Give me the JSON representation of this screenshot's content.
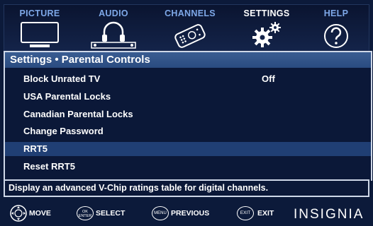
{
  "menu": {
    "tabs": [
      {
        "label": "PICTURE",
        "icon": "tv-icon"
      },
      {
        "label": "AUDIO",
        "icon": "headphones-icon"
      },
      {
        "label": "CHANNELS",
        "icon": "remote-icon"
      },
      {
        "label": "SETTINGS",
        "icon": "gears-icon",
        "active": true
      },
      {
        "label": "HELP",
        "icon": "question-icon"
      }
    ]
  },
  "panel": {
    "title": "Settings • Parental Controls",
    "items": [
      {
        "label": "Block Unrated TV",
        "value": "Off"
      },
      {
        "label": "USA Parental Locks"
      },
      {
        "label": "Canadian Parental Locks"
      },
      {
        "label": "Change Password"
      },
      {
        "label": "RRT5",
        "selected": true
      },
      {
        "label": "Reset RRT5"
      }
    ]
  },
  "description": "Display an advanced V-Chip ratings table for digital channels.",
  "footer": {
    "hints": [
      {
        "label": "MOVE",
        "icon": "dpad-icon"
      },
      {
        "button": "OK ENTER",
        "label": "SELECT"
      },
      {
        "button": "MENU",
        "label": "PREVIOUS"
      },
      {
        "button": "EXIT",
        "label": "EXIT"
      }
    ],
    "brand": "INSIGNIA"
  },
  "colors": {
    "background": "#0c1a3a",
    "title_bar": "#2a4b80",
    "selected_row": "#203f74",
    "tab_label": "#7ea8e8",
    "active_tab_label": "#ffffff"
  }
}
